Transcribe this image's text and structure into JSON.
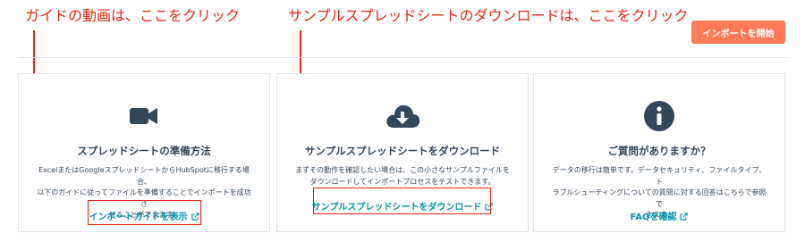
{
  "annotations": {
    "guide_note": "ガイドの動画は、ここをクリック",
    "sample_note": "サンプルスプレッドシートのダウンロードは、ここをクリック"
  },
  "header": {
    "start_import_label": "インポートを開始"
  },
  "cards": [
    {
      "icon": "video-camera-icon",
      "title": "スプレッドシートの準備方法",
      "desc_lines": [
        "ExcelまたはGoogleスプレッドシートからHubSpotに移行する場合、",
        "以下のガイドに従ってファイルを準備することでインポートを成功さ",
        "せることができます。"
      ],
      "link": "インポートガイドを表示"
    },
    {
      "icon": "cloud-download-icon",
      "title": "サンプルスプレッドシートをダウンロード",
      "desc_lines": [
        "まずその動作を確認したい場合は、この小さなサンプルファイルを",
        "ダウンロードしてインポートプロセスをテストできます。"
      ],
      "link": "サンプルスプレッドシートをダウンロード"
    },
    {
      "icon": "info-icon",
      "title": "ご質問がありますか？",
      "desc_lines": [
        "データの移行は簡単です。データセキュリティ、ファイルタイプ、ト",
        "ラブルシューティングについての質問に対する回答はこちらで参照で",
        "きます。"
      ],
      "link": "FAQを確認"
    }
  ],
  "colors": {
    "accent": "#ff7a59",
    "link": "#0091ae",
    "text": "#33475b",
    "annotation": "#e8260e",
    "border": "#dfe3eb"
  }
}
